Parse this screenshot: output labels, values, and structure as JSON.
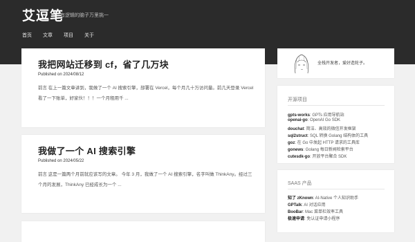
{
  "header": {
    "title": "艾逗笔",
    "description": "有逻辑的脑子万里挑一",
    "nav": [
      "首页",
      "文章",
      "项目",
      "关于"
    ]
  },
  "posts": [
    {
      "title": "我把网站迁移到 cf，省了几万块",
      "meta": "Published on 2024/08/12",
      "excerpt": "前言 在上一篇文章讲到，我做了一个 AI 搜索引擎，部署在 Vercel，每个月几十万访问量。前几天登录 Vercel 看了一下账单，好家伙！！！一个月租用千 ..."
    },
    {
      "title": "我做了一个 AI 搜索引擎",
      "meta": "Published on 2024/05/22",
      "excerpt": "前言 这是一篇两个月前就应该写的文章。 今年 3 月，我做了一个 AI 搜索引擎，名字叫做 ThinkAny。经过三个月的发展，ThinkAny 已经成长为一个 ..."
    }
  ],
  "sidebar": {
    "profile_text": "全栈开发者，爱好造轮子。",
    "open_source": {
      "title": "开源项目",
      "items": [
        {
          "name": "gpts-works",
          "desc": ": GPTs 应用导航站"
        },
        {
          "name": "openai-go",
          "desc": ": OpenAI Go SDK"
        },
        {
          "name": "douchat",
          "desc": ": 简洁、高效的微信开发框架"
        },
        {
          "name": "sql2struct",
          "desc": ": SQL 转换 Golang 结构体的工具"
        },
        {
          "name": "goz",
          "desc": ": 在 Go 中发起 HTTP 请求的工具库"
        },
        {
          "name": "gonews",
          "desc": ": Golang 每日新闻检索平台"
        },
        {
          "name": "cutesdk-go",
          "desc": ": 开放平台聚合 SDK"
        }
      ]
    },
    "saas": {
      "title": "SAAS 产品",
      "items": [
        {
          "name": "知了 zKnown",
          "desc": ": AI-Native 个人知识助手"
        },
        {
          "name": "GPTalk",
          "desc": ": AI 对话应用"
        },
        {
          "name": "BooBar",
          "desc": ": Mac 菜单栏效率工具"
        },
        {
          "name": "极速申请",
          "desc": ": 免认证申请小程序"
        }
      ]
    }
  }
}
